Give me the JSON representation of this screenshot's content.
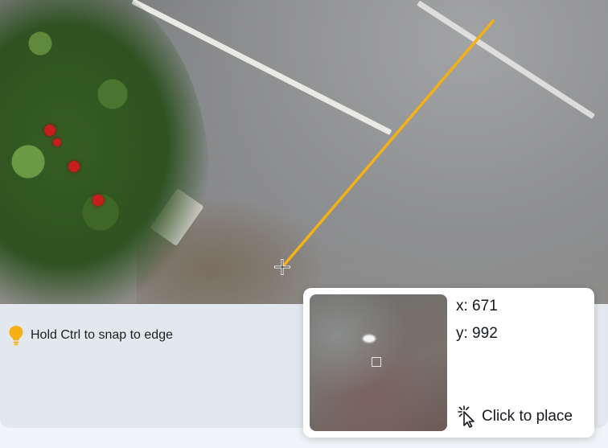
{
  "hint": {
    "icon": "lightbulb-icon",
    "text": "Hold Ctrl to snap to edge"
  },
  "magnifier": {
    "x_label": "x: 671",
    "y_label": "y: 992",
    "action_icon": "click-cursor-icon",
    "action_label": "Click to place"
  },
  "colors": {
    "measure_line": "#f5b014",
    "hint_icon": "#f5b014",
    "panel": "#e3e8ef"
  }
}
